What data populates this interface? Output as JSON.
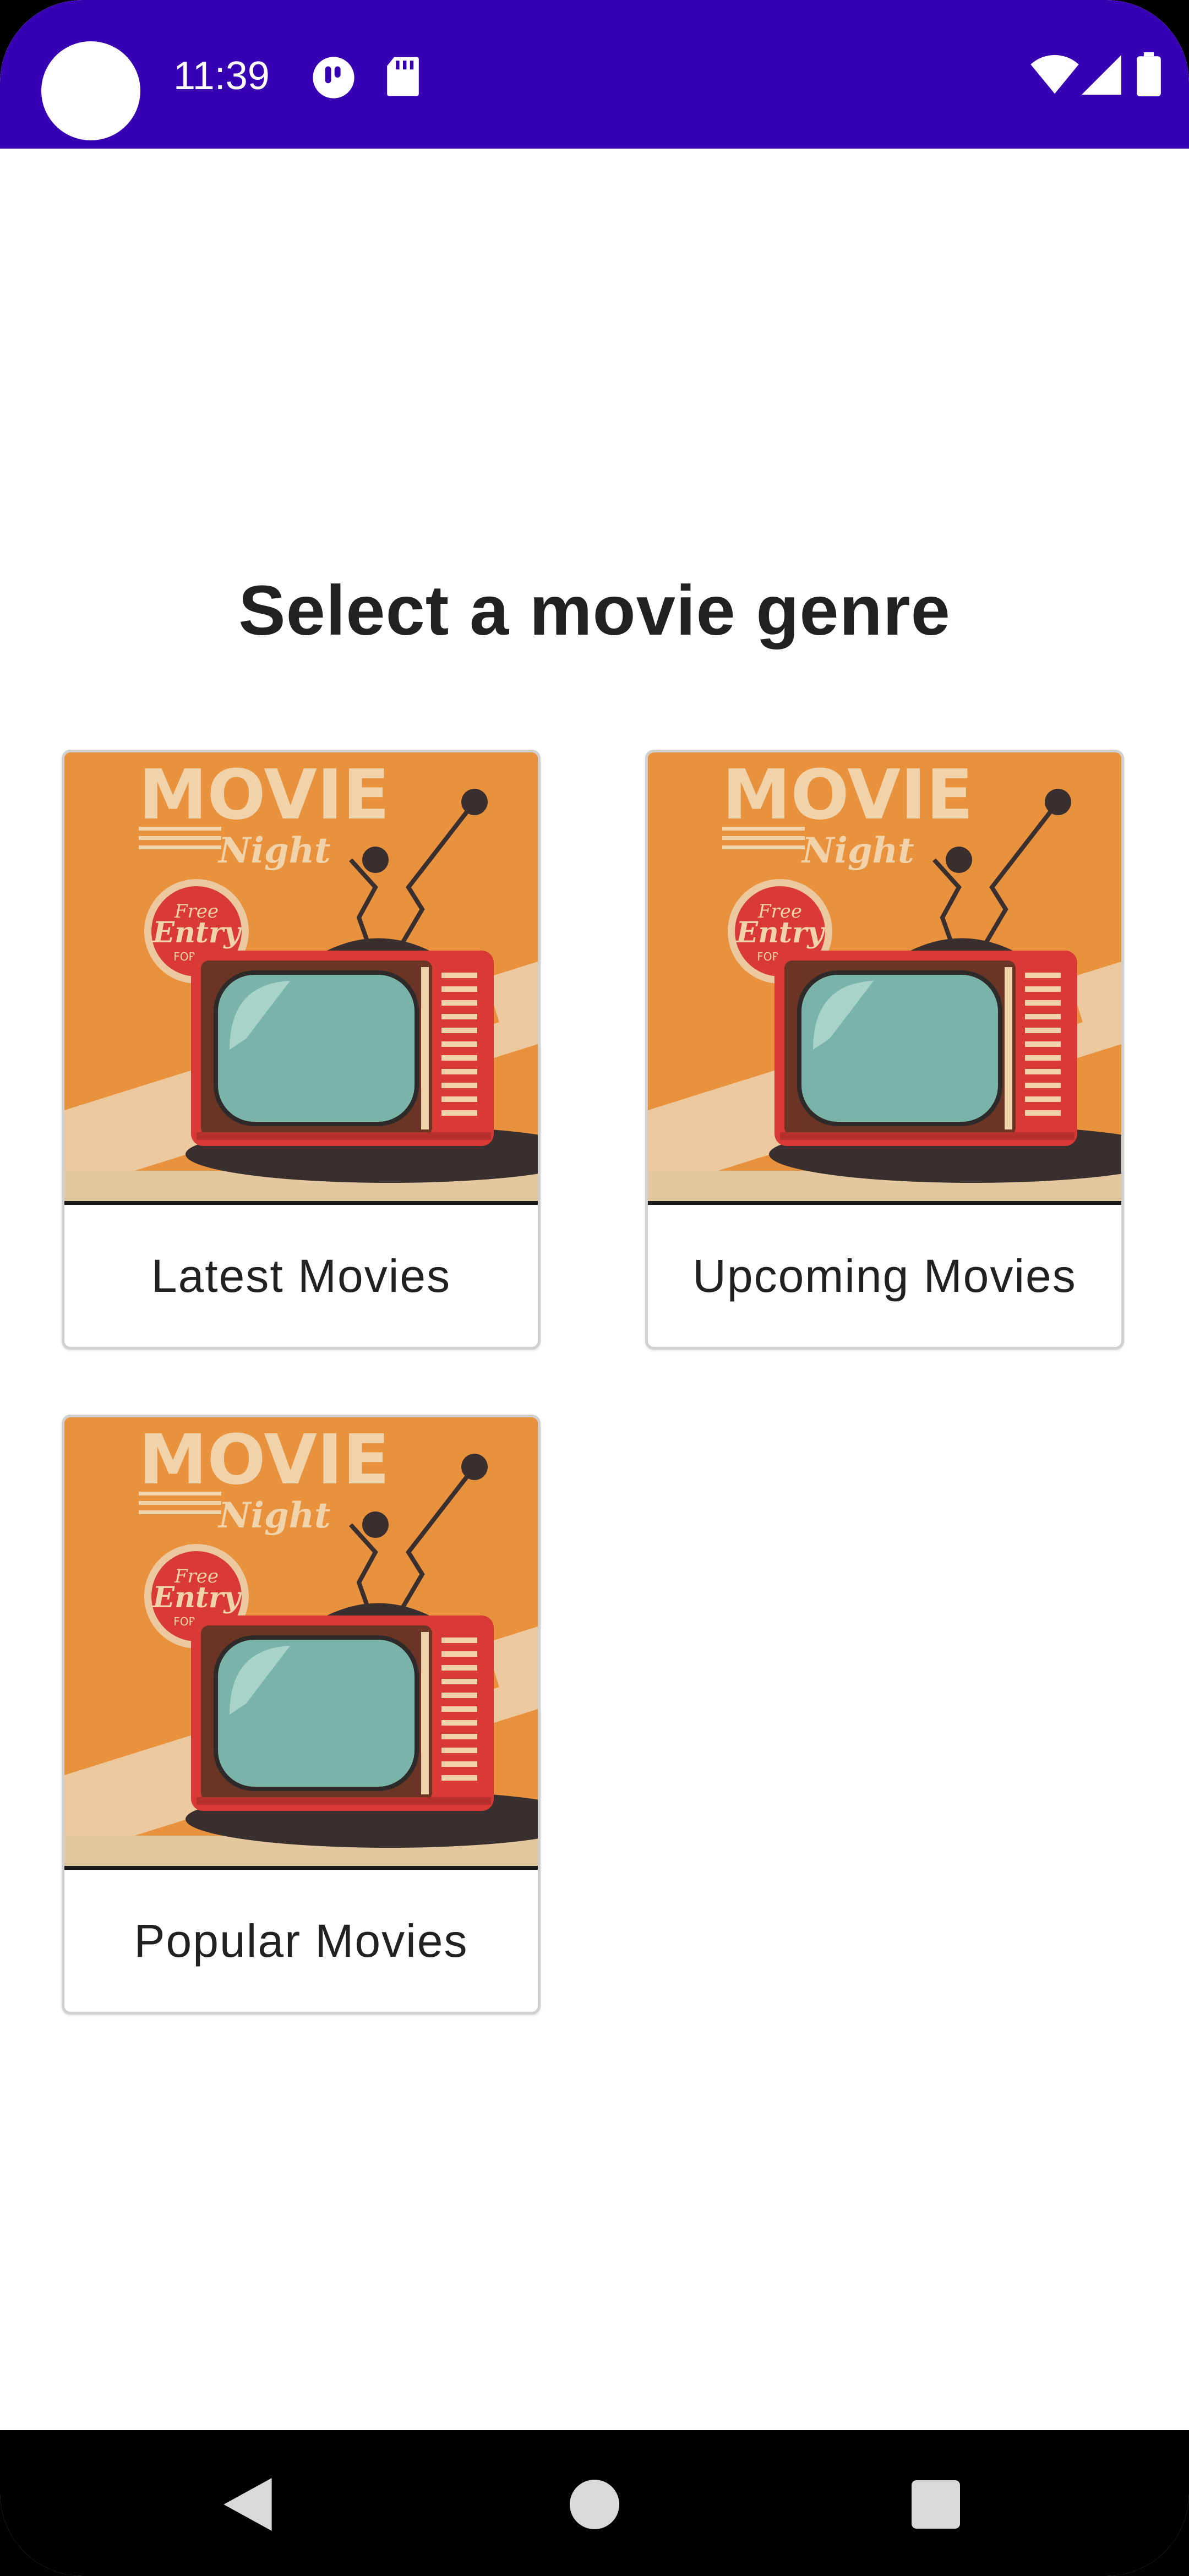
{
  "status_bar": {
    "time": "11:39",
    "background": "#3700B3",
    "icons_left": [
      "app-notification-icon",
      "sd-card-icon"
    ],
    "icons_right": [
      "wifi-icon",
      "cellular-signal-icon",
      "battery-icon"
    ]
  },
  "main": {
    "title": "Select a movie genre",
    "cards": [
      {
        "label": "Latest Movies",
        "poster": {
          "heading": "MOVIE",
          "script": "Night",
          "badge_line1": "Free",
          "badge_line2": "Entry",
          "badge_line3": "FOR ALL"
        }
      },
      {
        "label": "Upcoming Movies",
        "poster": {
          "heading": "MOVIE",
          "script": "Night",
          "badge_line1": "Free",
          "badge_line2": "Entry",
          "badge_line3": "FOR ALL"
        }
      },
      {
        "label": "Popular Movies",
        "poster": {
          "heading": "MOVIE",
          "script": "Night",
          "badge_line1": "Free",
          "badge_line2": "Entry",
          "badge_line3": "FOR ALL"
        }
      }
    ]
  },
  "nav_bar": {
    "buttons": [
      "back-icon",
      "home-icon",
      "recents-icon"
    ]
  },
  "colors": {
    "accent": "#3700B3",
    "poster_orange": "#E8923D",
    "tv_red": "#D93A35",
    "screen_teal": "#7AB3A8"
  }
}
